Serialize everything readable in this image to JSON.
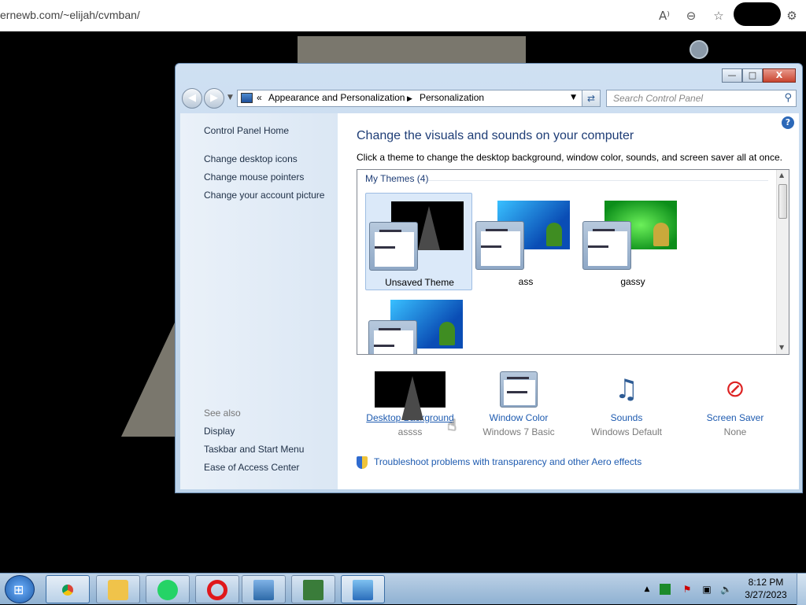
{
  "browser": {
    "url": "ernewb.com/~elijah/cvmban/",
    "icons": [
      "read-aloud-icon",
      "zoom-out-icon",
      "favorites-add-icon",
      "settings-icon"
    ]
  },
  "window": {
    "title": "Personalization",
    "breadcrumb_prefix": "«",
    "breadcrumb": [
      "Appearance and Personalization",
      "Personalization"
    ],
    "search_placeholder": "Search Control Panel",
    "caption_buttons": {
      "minimize": "—",
      "maximize": "□",
      "close": "X"
    }
  },
  "left_pane": {
    "home": "Control Panel Home",
    "links": [
      "Change desktop icons",
      "Change mouse pointers",
      "Change your account picture"
    ],
    "see_also_label": "See also",
    "see_also": [
      "Display",
      "Taskbar and Start Menu",
      "Ease of Access Center"
    ]
  },
  "main": {
    "title": "Change the visuals and sounds on your computer",
    "subtitle": "Click a theme to change the desktop background, window color, sounds, and screen saver all at once.",
    "group_label": "My Themes (4)",
    "themes": [
      {
        "name": "Unsaved Theme",
        "selected": true
      },
      {
        "name": "ass",
        "selected": false
      },
      {
        "name": "gassy",
        "selected": false
      },
      {
        "name": "",
        "selected": false
      }
    ],
    "bottom_items": [
      {
        "label": "Desktop Background",
        "value": "assss"
      },
      {
        "label": "Window Color",
        "value": "Windows 7 Basic"
      },
      {
        "label": "Sounds",
        "value": "Windows Default"
      },
      {
        "label": "Screen Saver",
        "value": "None"
      }
    ],
    "troubleshoot": "Troubleshoot problems with transparency and other Aero effects"
  },
  "taskbar": {
    "pinned": [
      "windows-explorer-icon",
      "chrome-icon",
      "whatsapp-icon",
      "opera-icon",
      "photo-viewer-icon",
      "monitor-icon",
      "control-panel-icon"
    ],
    "clock_time": "8:12 PM",
    "clock_date": "3/27/2023"
  },
  "colors": {
    "accent_link": "#1e5bb0",
    "title_blue": "#1e3d76",
    "close_red": "#c9452f"
  }
}
